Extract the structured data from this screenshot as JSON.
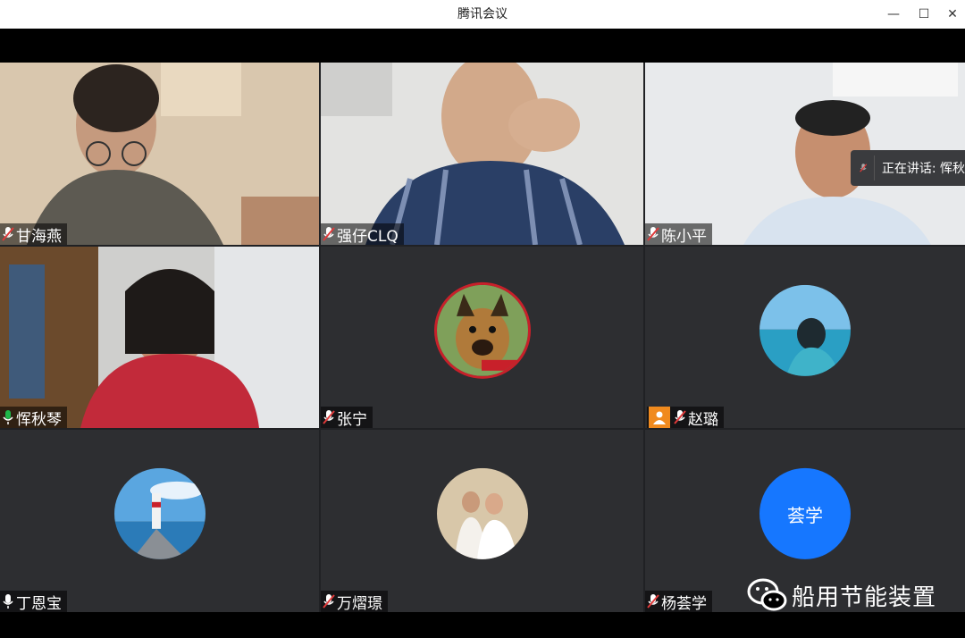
{
  "window": {
    "title": "腾讯会议",
    "controls": {
      "minimize": "—",
      "maximize": "☐",
      "close": "✕"
    }
  },
  "speaking_popup": {
    "text": "正在讲话: 恽秋"
  },
  "participants": [
    {
      "name": "甘海燕",
      "mic": "muted"
    },
    {
      "name": "强仔CLQ",
      "mic": "muted"
    },
    {
      "name": "陈小平",
      "mic": "muted"
    },
    {
      "name": "恽秋琴",
      "mic": "active"
    },
    {
      "name": "张宁",
      "mic": "muted",
      "avatar": "dog-avatar"
    },
    {
      "name": "赵璐",
      "mic": "muted",
      "avatar": "sea-child-avatar",
      "host": true
    },
    {
      "name": "丁恩宝",
      "mic": "on",
      "avatar": "lighthouse-avatar"
    },
    {
      "name": "万熠璟",
      "mic": "muted",
      "avatar": "wedding-photo-avatar"
    },
    {
      "name": "杨荟学",
      "mic": "muted",
      "avatar_text": "荟学"
    }
  ],
  "watermark": {
    "text": "船用节能装置"
  },
  "colors": {
    "accent_blue": "#1677ff",
    "active_green": "#1fb84a",
    "host_orange": "#f08a1e"
  }
}
